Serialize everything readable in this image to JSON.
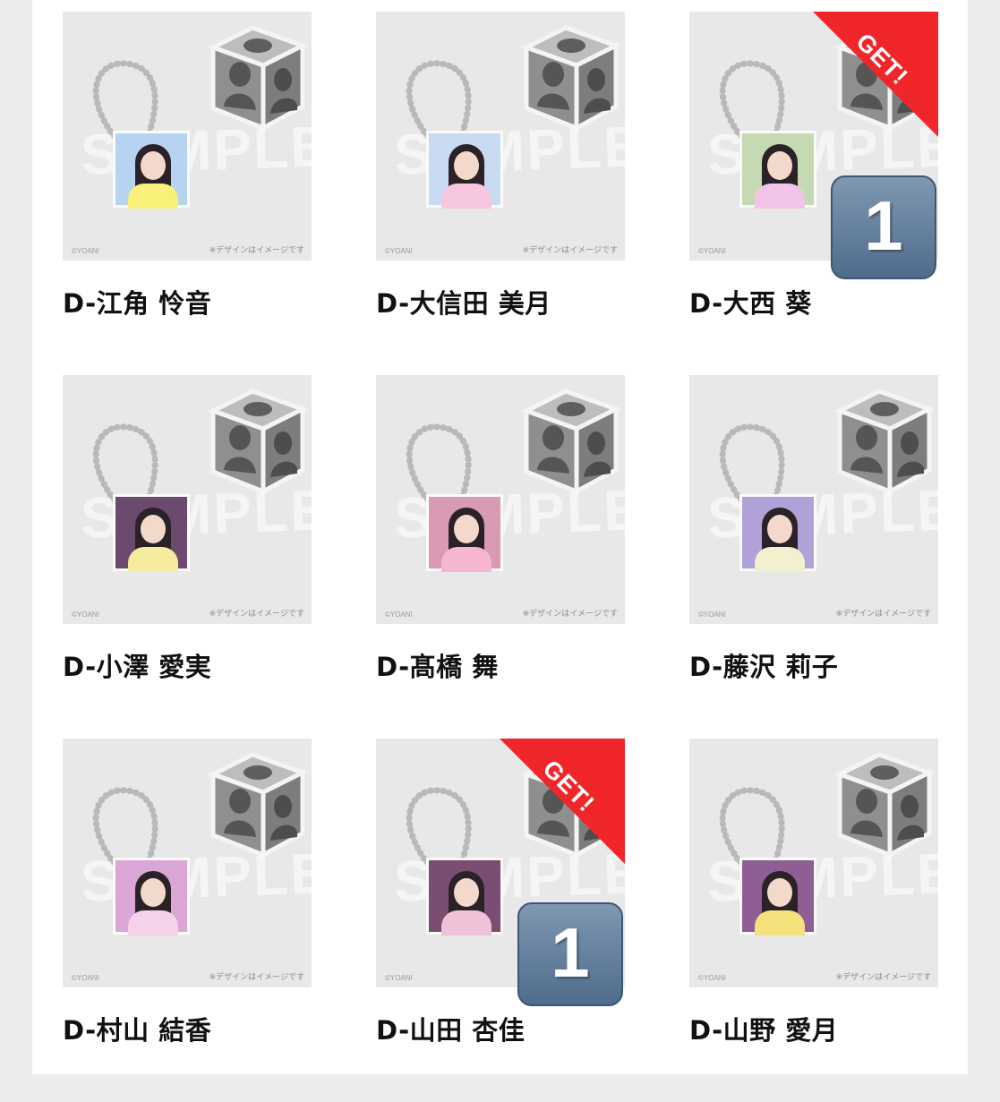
{
  "watermark": "SAMPLE",
  "copyright": "©YOANI",
  "image_note": "※デザインはイメージです",
  "get_label": "GET!",
  "items": [
    {
      "name": "D-江角 怜音",
      "get": false,
      "count": "",
      "photo_bg": "#b6d4ef",
      "body": "#f7f079"
    },
    {
      "name": "D-大信田 美月",
      "get": false,
      "count": "",
      "photo_bg": "#c9dbf2",
      "body": "#f6c7df"
    },
    {
      "name": "D-大西 葵",
      "get": true,
      "count": "1",
      "photo_bg": "#c5d9b2",
      "body": "#f3c4ea"
    },
    {
      "name": "D-小澤 愛実",
      "get": false,
      "count": "",
      "photo_bg": "#6a4b6e",
      "body": "#f5ec9f"
    },
    {
      "name": "D-髙橋 舞",
      "get": false,
      "count": "",
      "photo_bg": "#d99ab6",
      "body": "#f4b7cf"
    },
    {
      "name": "D-藤沢 莉子",
      "get": false,
      "count": "",
      "photo_bg": "#b0a1d8",
      "body": "#f2f0ce"
    },
    {
      "name": "D-村山 結香",
      "get": false,
      "count": "",
      "photo_bg": "#d9a6d6",
      "body": "#f3d2ea"
    },
    {
      "name": "D-山田 杏佳",
      "get": true,
      "count": "1",
      "photo_bg": "#7c4d72",
      "body": "#f1c1d8"
    },
    {
      "name": "D-山野 愛月",
      "get": false,
      "count": "",
      "photo_bg": "#8e5e95",
      "body": "#f5e27d"
    }
  ]
}
